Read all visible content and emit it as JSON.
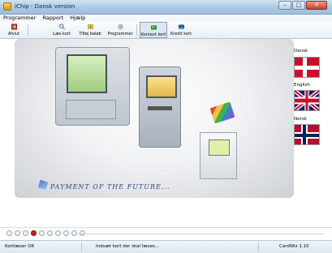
{
  "window": {
    "title": "iChip - Dansk version",
    "buttons": [
      "–",
      "□",
      "✕"
    ]
  },
  "menu": [
    "Programmer",
    "Rapport",
    "Hjælp"
  ],
  "toolbar": {
    "exit": "Afslut",
    "read_card": "Læs kort",
    "recharge": "Tilføj beløb",
    "program": "Programmér",
    "cash_card": "Kontant kort",
    "credit_card": "Kredit kort"
  },
  "hero": {
    "tagline": "PAYMENT OF THE FUTURE..."
  },
  "languages": {
    "danish": "Dansk",
    "english": "English",
    "norwegian": "Norsk"
  },
  "progress": {
    "total": 10,
    "active_index": 3
  },
  "status": {
    "left": "Kortlæser OK",
    "center": "Indsæt kort der skal læses...",
    "right": "CardWiz 1.10"
  },
  "colors": {
    "accent": "#2a4b87",
    "active_dot": "#c32424"
  }
}
